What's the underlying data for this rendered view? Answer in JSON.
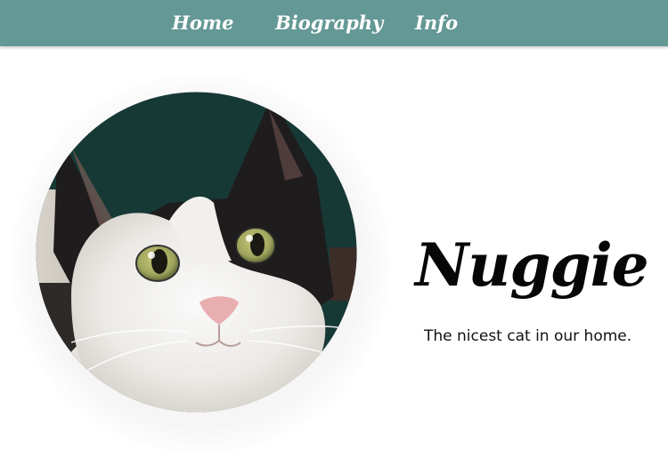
{
  "nav": {
    "home": "Home",
    "biography": "Biography",
    "info": "Info"
  },
  "hero": {
    "name": "Nuggie",
    "tagline": "The nicest cat in our home.",
    "photo_alt": "cat-portrait"
  },
  "colors": {
    "navbar": "#649895",
    "nav_text": "#ffffff",
    "title": "#070707",
    "text": "#111111"
  }
}
